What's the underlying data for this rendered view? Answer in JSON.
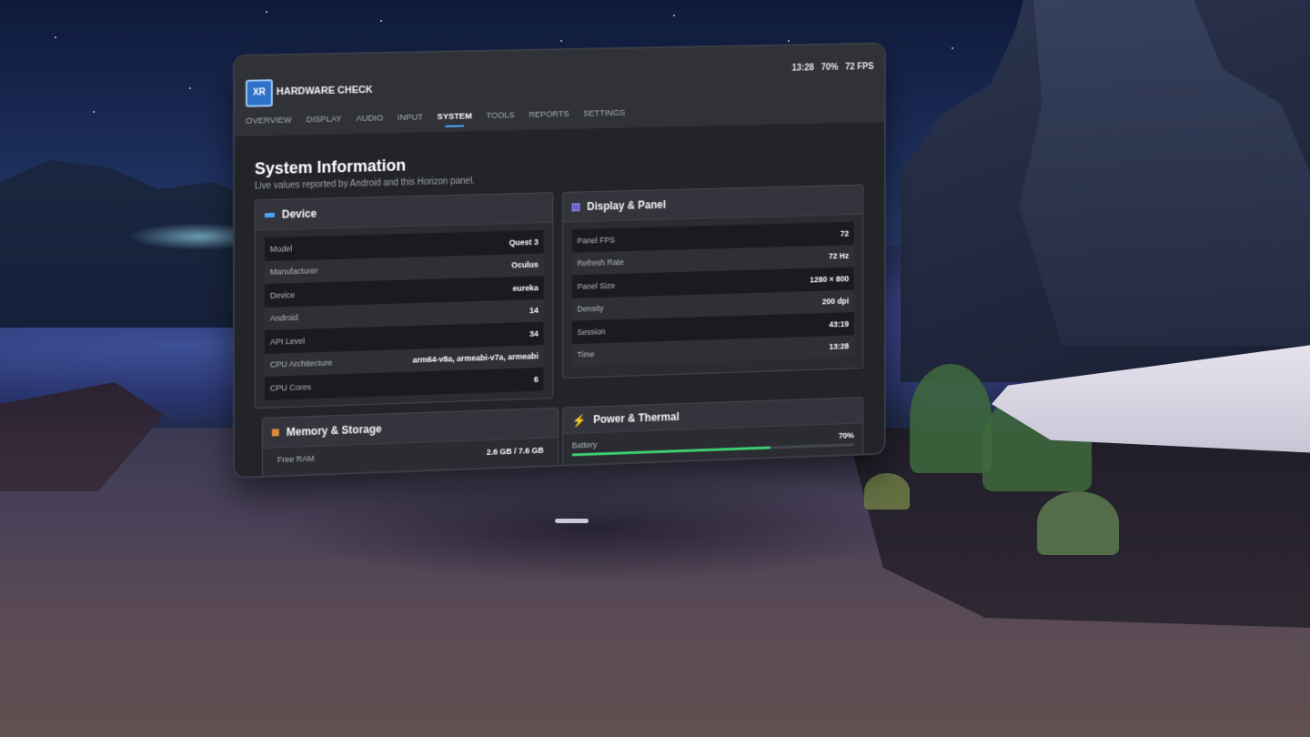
{
  "app": {
    "logo_text": "XR",
    "title": "HARDWARE CHECK"
  },
  "status": {
    "time": "13:28",
    "battery": "70%",
    "fps": "72 FPS"
  },
  "tabs": [
    {
      "label": "OVERVIEW",
      "active": false
    },
    {
      "label": "DISPLAY",
      "active": false
    },
    {
      "label": "AUDIO",
      "active": false
    },
    {
      "label": "INPUT",
      "active": false
    },
    {
      "label": "SYSTEM",
      "active": true
    },
    {
      "label": "TOOLS",
      "active": false
    },
    {
      "label": "REPORTS",
      "active": false
    },
    {
      "label": "SETTINGS",
      "active": false
    }
  ],
  "page": {
    "title": "System Information",
    "subtitle": "Live values reported by Android and this Horizon panel."
  },
  "device": {
    "title": "Device",
    "icon": "device-icon",
    "rows": [
      {
        "label": "Model",
        "value": "Quest 3"
      },
      {
        "label": "Manufacturer",
        "value": "Oculus"
      },
      {
        "label": "Device",
        "value": "eureka"
      },
      {
        "label": "Android",
        "value": "14"
      },
      {
        "label": "API Level",
        "value": "34"
      },
      {
        "label": "CPU Architecture",
        "value": "arm64-v8a, armeabi-v7a, armeabi"
      },
      {
        "label": "CPU Cores",
        "value": "6"
      }
    ]
  },
  "display_panel": {
    "title": "Display & Panel",
    "icon": "display-icon",
    "rows": [
      {
        "label": "Panel FPS",
        "value": "72"
      },
      {
        "label": "Refresh Rate",
        "value": "72 Hz"
      },
      {
        "label": "Panel Size",
        "value": "1280 × 800"
      },
      {
        "label": "Density",
        "value": "200 dpi"
      },
      {
        "label": "Session",
        "value": "43:19"
      },
      {
        "label": "Time",
        "value": "13:28"
      }
    ]
  },
  "memory": {
    "title": "Memory & Storage",
    "icon": "memory-icon",
    "rows": [
      {
        "label": "Free RAM",
        "value": "2.6 GB / 7.6 GB"
      }
    ]
  },
  "power": {
    "title": "Power & Thermal",
    "icon": "lightning-icon",
    "battery_label": "Battery",
    "battery_value": "70%",
    "battery_fraction": 0.7,
    "battery_color": "#3ecf6e"
  },
  "colors": {
    "accent": "#4ea3ff",
    "panel_bg": "#23242a"
  }
}
